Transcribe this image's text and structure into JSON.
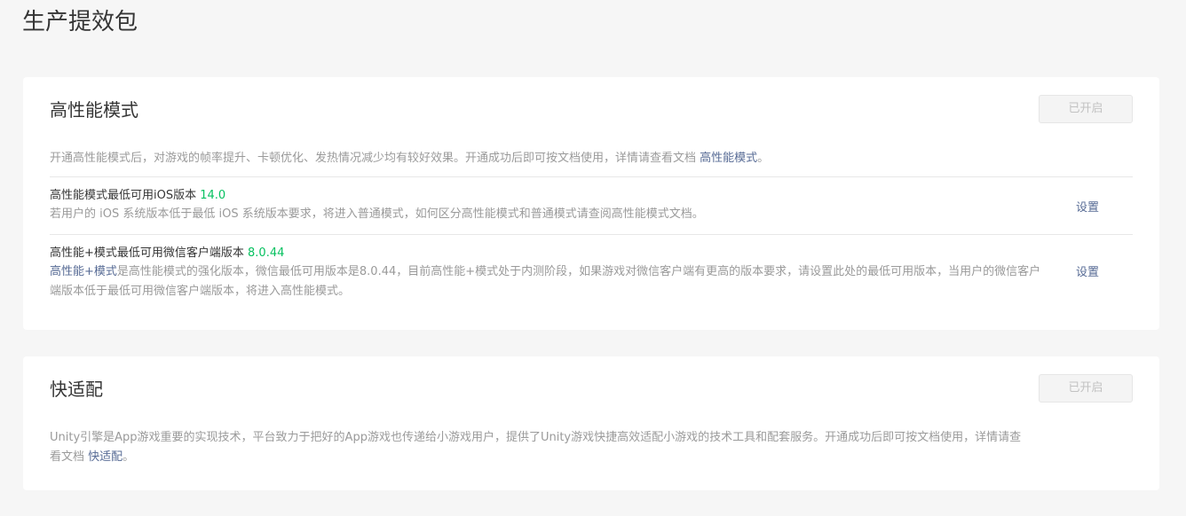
{
  "page": {
    "title": "生产提效包"
  },
  "performance": {
    "title": "高性能模式",
    "status_label": "已开启",
    "description_prefix": "开通高性能模式后，对游戏的帧率提升、卡顿优化、发热情况减少均有较好效果。开通成功后即可按文档使用，详情请查看文档 ",
    "description_link": "高性能模式",
    "description_suffix": "。",
    "ios_row": {
      "label": "高性能模式最低可用iOS版本 ",
      "version": "14.0",
      "description": "若用户的 iOS 系统版本低于最低 iOS 系统版本要求，将进入普通模式，如何区分高性能模式和普通模式请查阅高性能模式文档。",
      "action_label": "设置"
    },
    "wechat_row": {
      "label": "高性能+模式最低可用微信客户端版本 ",
      "version": "8.0.44",
      "description_link": "高性能+模式",
      "description": "是高性能模式的强化版本，微信最低可用版本是8.0.44，目前高性能+模式处于内测阶段，如果游戏对微信客户端有更高的版本要求，请设置此处的最低可用版本，当用户的微信客户端版本低于最低可用微信客户端版本，将进入高性能模式。",
      "action_label": "设置"
    }
  },
  "adaptation": {
    "title": "快适配",
    "status_label": "已开启",
    "description_prefix": "Unity引擎是App游戏重要的实现技术，平台致力于把好的App游戏也传递给小游戏用户，提供了Unity游戏快捷高效适配小游戏的技术工具和配套服务。开通成功后即可按文档使用，详情请查看文档 ",
    "description_link": "快适配",
    "description_suffix": "。"
  },
  "colors": {
    "accent_link": "#576b95",
    "version_green": "#07c160",
    "muted_text": "#9a9a9a",
    "page_bg": "#f6f6f6"
  }
}
